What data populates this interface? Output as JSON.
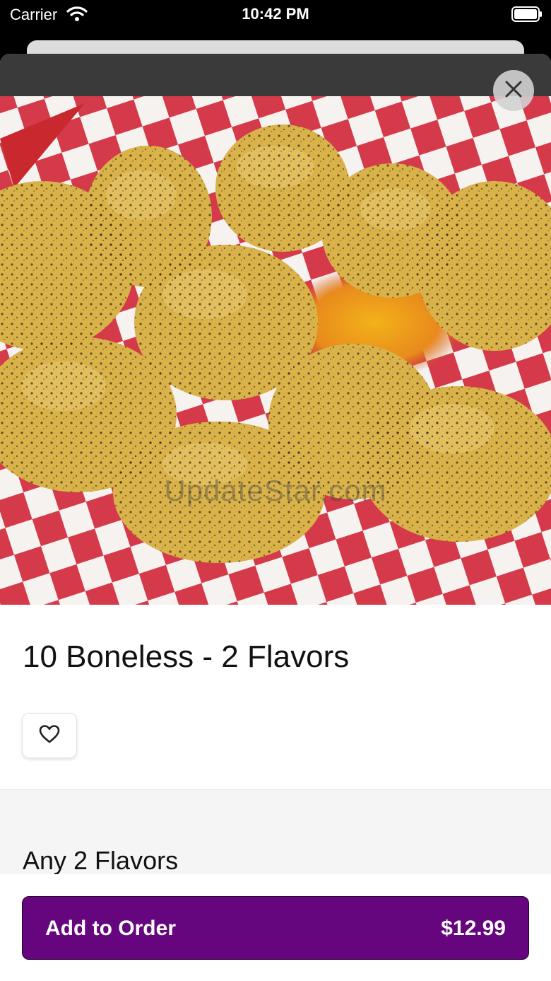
{
  "status_bar": {
    "carrier": "Carrier",
    "time": "10:42 PM",
    "icons": [
      "wifi-icon",
      "battery-icon"
    ]
  },
  "item": {
    "image_watermark": "UpdateStar.com",
    "title": "10 Boneless - 2 Flavors",
    "close_icon": "close-icon",
    "favorite_icon": "heart-icon"
  },
  "options": {
    "section_title": "Any 2 Flavors"
  },
  "order": {
    "add_label": "Add to Order",
    "price": "$12.99"
  },
  "colors": {
    "accent": "#66067f",
    "checker_red": "#d43a4a",
    "checker_white": "#f6f2f0",
    "food": "#d9b24a"
  }
}
